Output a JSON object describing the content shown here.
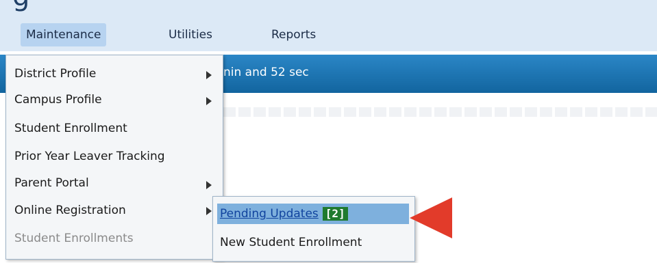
{
  "app": {
    "title_fragment": "g"
  },
  "menubar": {
    "items": [
      {
        "label": "Maintenance",
        "active": true
      },
      {
        "label": "Utilities",
        "active": false
      },
      {
        "label": "Reports",
        "active": false
      }
    ]
  },
  "status": {
    "timer_text": "nin and 52 sec"
  },
  "maintenance_menu": {
    "items": [
      {
        "label": "District Profile",
        "has_submenu": true,
        "enabled": true
      },
      {
        "label": "Campus Profile",
        "has_submenu": true,
        "enabled": true
      },
      {
        "label": "Student Enrollment",
        "has_submenu": false,
        "enabled": true
      },
      {
        "label": "Prior Year Leaver Tracking",
        "has_submenu": false,
        "enabled": true
      },
      {
        "label": "Parent Portal",
        "has_submenu": true,
        "enabled": true
      },
      {
        "label": "Online Registration",
        "has_submenu": true,
        "enabled": true
      },
      {
        "label": "Student Enrollments",
        "has_submenu": false,
        "enabled": false
      }
    ]
  },
  "online_registration_submenu": {
    "items": [
      {
        "label": "Pending Updates",
        "badge": "[2]",
        "highlighted": true
      },
      {
        "label": "New Student Enrollment",
        "highlighted": false
      }
    ]
  },
  "colors": {
    "accent_blue": "#1a73b8",
    "badge_green": "#1f7a2e",
    "callout_red": "#e23b2a"
  },
  "icons": {
    "submenu_indicator": "triangle-right-icon",
    "callout": "red-arrow-pointer-icon"
  }
}
